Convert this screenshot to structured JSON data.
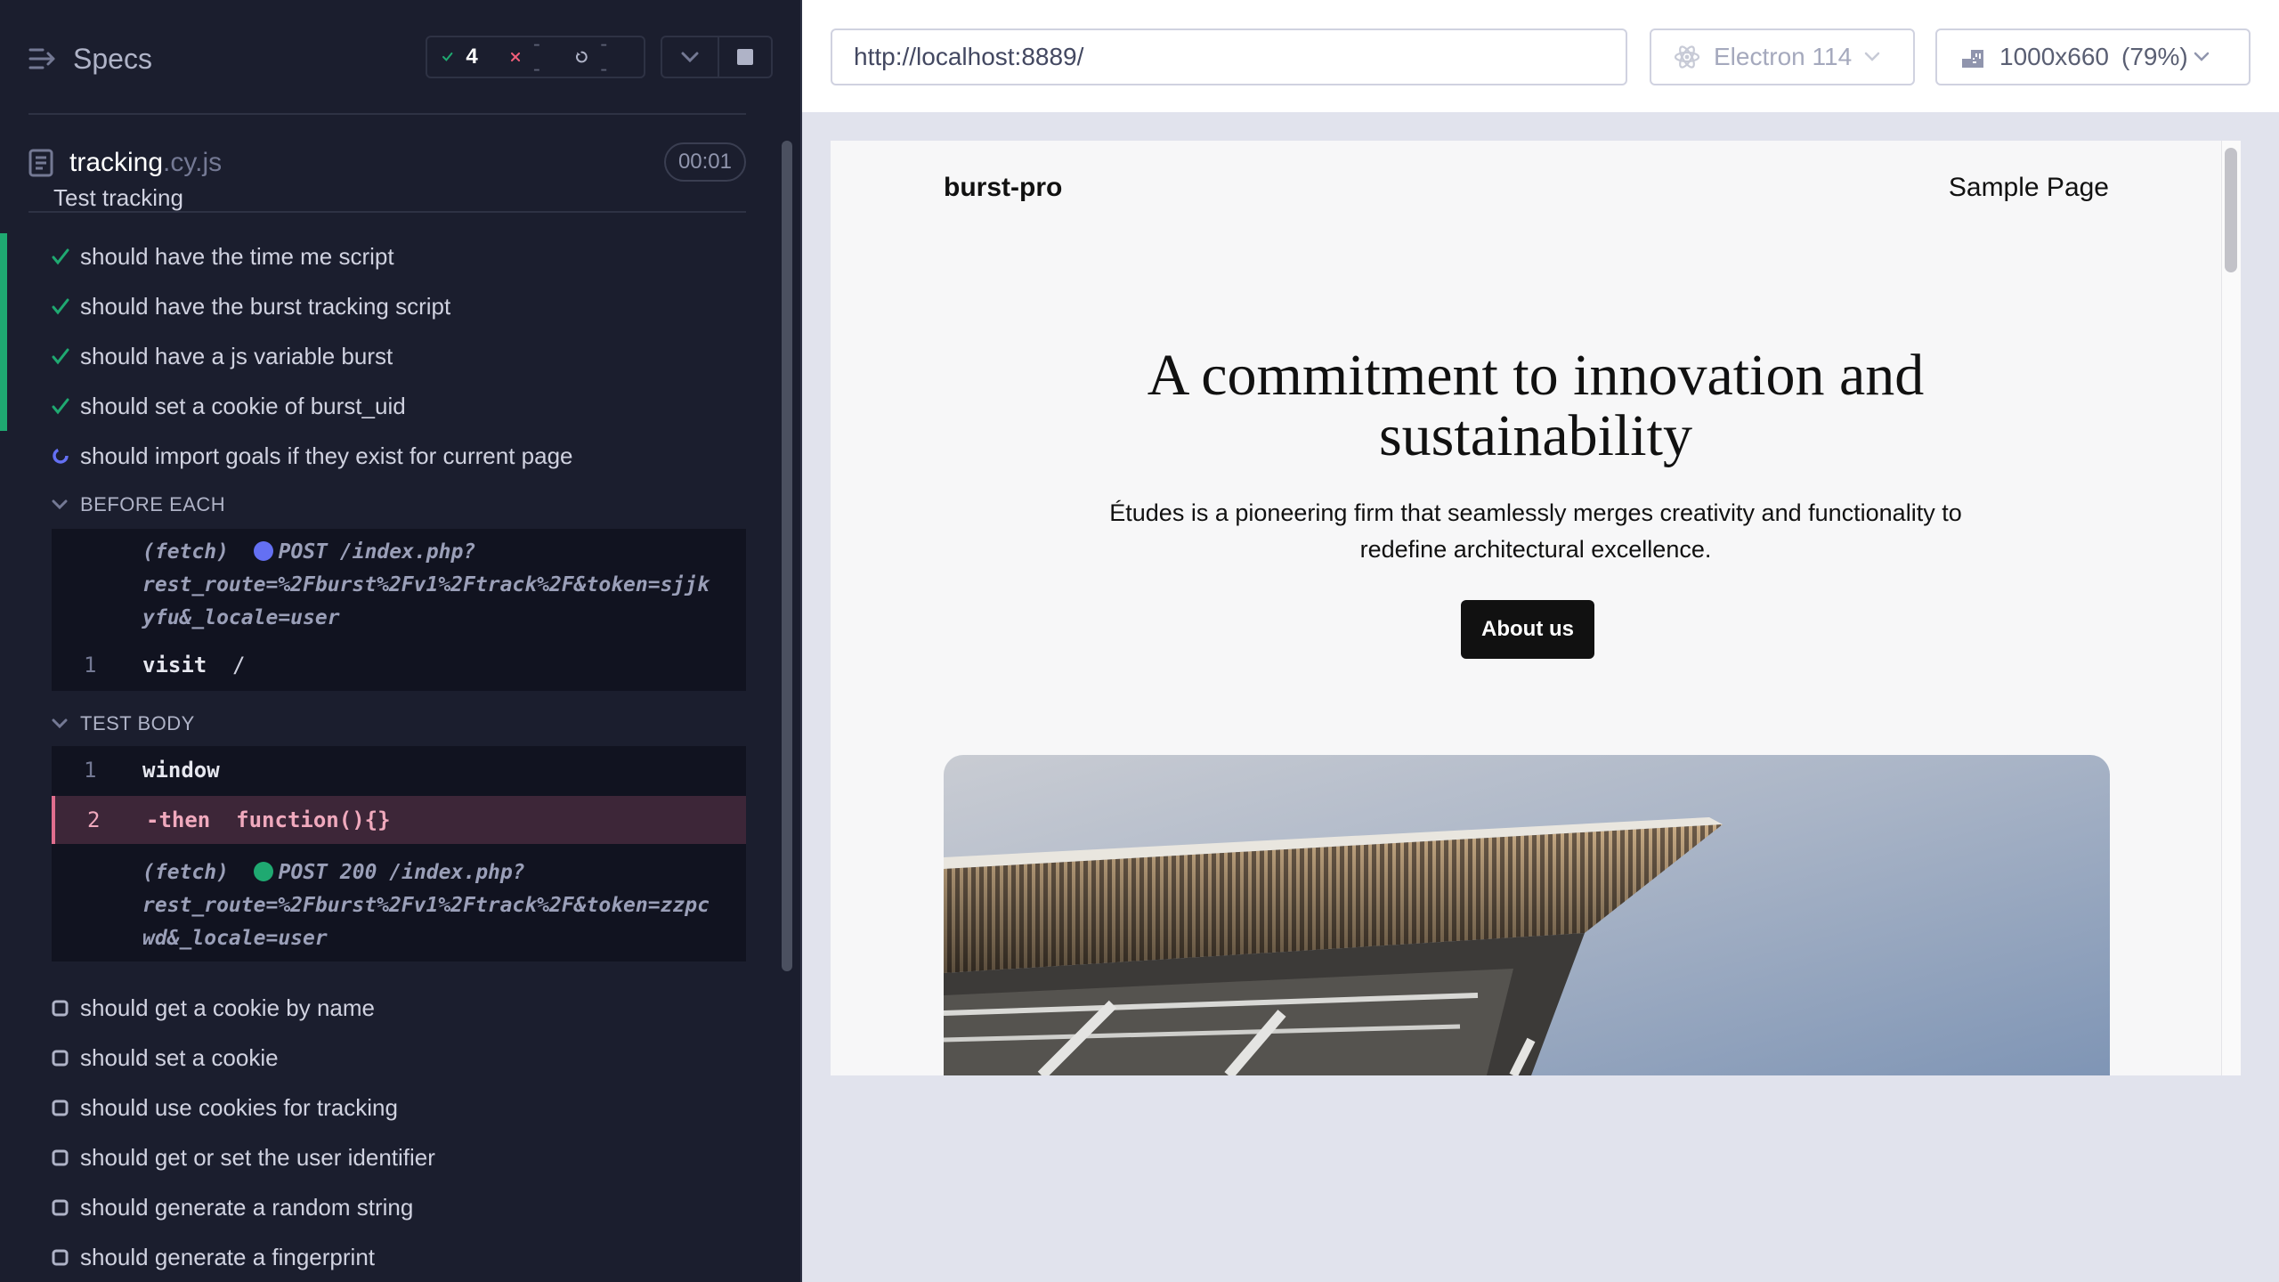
{
  "runner": {
    "specs_label": "Specs",
    "stats": {
      "passed": "4",
      "failed": "--",
      "pending": "--"
    },
    "file": {
      "name": "tracking",
      "ext": ".cy.js",
      "duration": "00:01"
    },
    "suite_title": "Test tracking",
    "tests": [
      {
        "label": "should have the time me script",
        "state": "passed"
      },
      {
        "label": "should have the burst tracking script",
        "state": "passed"
      },
      {
        "label": "should have a js variable burst",
        "state": "passed"
      },
      {
        "label": "should set a cookie of burst_uid",
        "state": "passed"
      },
      {
        "label": "should import goals if they exist for current page",
        "state": "running"
      },
      {
        "label": "should get a cookie by name",
        "state": "queued"
      },
      {
        "label": "should set a cookie",
        "state": "queued"
      },
      {
        "label": "should use cookies for tracking",
        "state": "queued"
      },
      {
        "label": "should get or set the user identifier",
        "state": "queued"
      },
      {
        "label": "should generate a random string",
        "state": "queued"
      },
      {
        "label": "should generate a fingerprint",
        "state": "queued"
      }
    ],
    "before_each": {
      "label": "BEFORE EACH",
      "fetch": {
        "prefix": "(fetch)",
        "lines": [
          "POST /index.php?",
          "rest_route=%2Fburst%2Fv1%2Ftrack%2F&token=sjjk",
          "yfu&_locale=user"
        ]
      },
      "command": {
        "num": "1",
        "name": "visit",
        "arg": "/"
      }
    },
    "test_body": {
      "label": "TEST BODY",
      "commands": [
        {
          "num": "1",
          "name": "window",
          "arg": ""
        },
        {
          "num": "2",
          "name": "-then",
          "arg": "function(){}"
        }
      ],
      "fetch": {
        "prefix": "(fetch)",
        "lines": [
          "POST 200 /index.php?",
          "rest_route=%2Fburst%2Fv1%2Ftrack%2F&token=zzpc",
          "wd&_locale=user"
        ]
      }
    },
    "colors": {
      "pass": "#1fa971",
      "fail": "#f15f7a",
      "active": "#e06e8e",
      "pending_dot": "#6470f3",
      "success_dot": "#1fa971"
    }
  },
  "aut": {
    "url": "http://localhost:8889/",
    "browser": "Electron 114",
    "viewport": "1000x660",
    "zoom": "(79%)"
  },
  "site": {
    "brand": "burst-pro",
    "nav_link": "Sample Page",
    "hero_title": "A commitment to innovation and sustainability",
    "hero_description": "Études is a pioneering firm that seamlessly merges creativity and functionality to redefine architectural excellence.",
    "hero_button": "About us"
  }
}
